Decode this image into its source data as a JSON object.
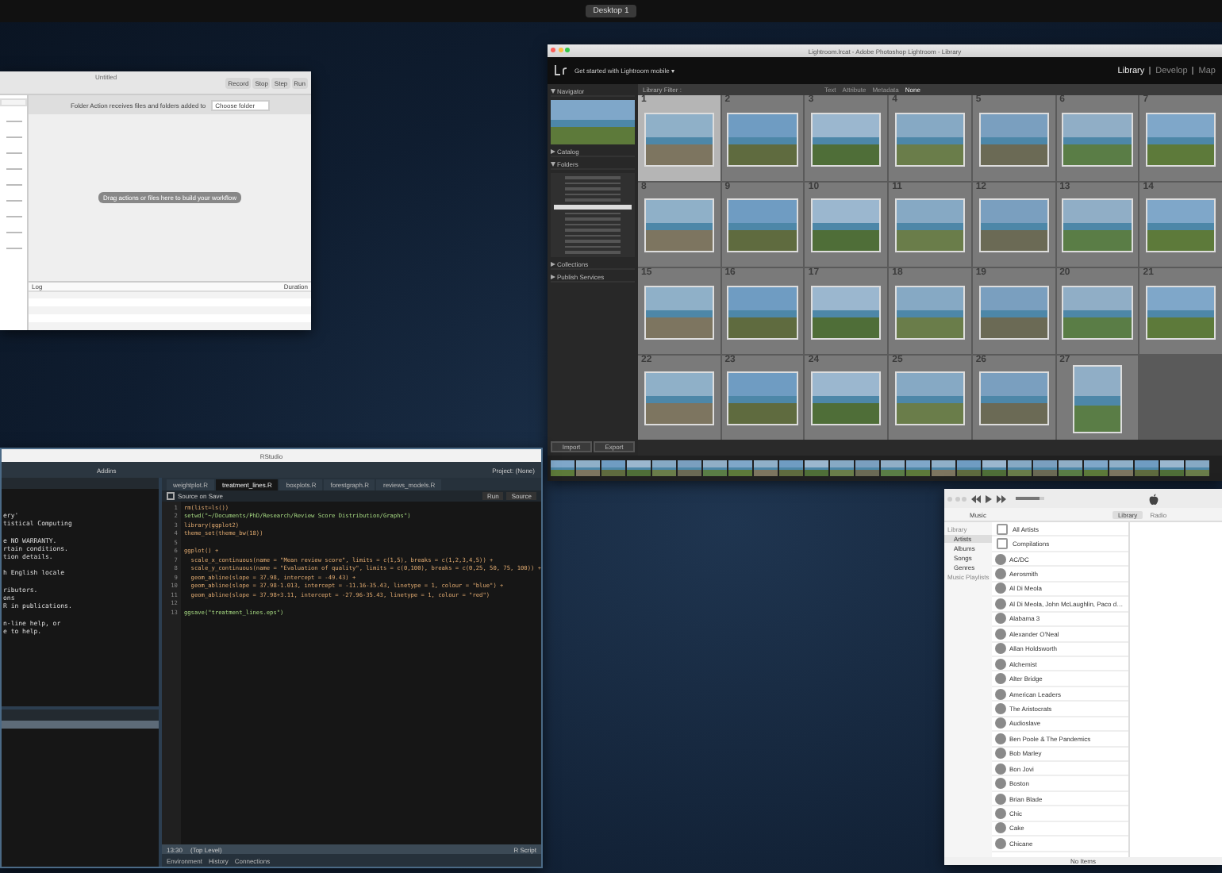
{
  "desktop_label": "Desktop 1",
  "automator": {
    "title": "Untitled",
    "toolbar": [
      "Record",
      "Stop",
      "Step",
      "Run"
    ],
    "receives_text": "Folder Action receives files and folders added to",
    "folder_value": "Choose folder",
    "hint": "Drag actions or files here to build your workflow",
    "log_columns": [
      "Log",
      "Duration"
    ]
  },
  "lightroom": {
    "title": "Lightroom.lrcat - Adobe Photoshop Lightroom - Library",
    "mobile_prompt": "Get started with Lightroom mobile ▾",
    "modules": [
      {
        "label": "Library",
        "selected": true
      },
      {
        "label": "Develop",
        "selected": false
      },
      {
        "label": "Map",
        "selected": false
      }
    ],
    "panels": [
      {
        "label": "Navigator",
        "expanded": true
      },
      {
        "label": "Catalog",
        "expanded": false
      },
      {
        "label": "Folders",
        "expanded": true
      },
      {
        "label": "Collections",
        "expanded": false
      },
      {
        "label": "Publish Services",
        "expanded": false
      }
    ],
    "filter_label": "Library Filter :",
    "filters": [
      {
        "label": "Text",
        "selected": false
      },
      {
        "label": "Attribute",
        "selected": false
      },
      {
        "label": "Metadata",
        "selected": false
      },
      {
        "label": "None",
        "selected": true
      }
    ],
    "grid": [
      {
        "number": "1",
        "selected": true
      },
      {
        "number": "2",
        "selected": false
      },
      {
        "number": "3",
        "selected": false
      },
      {
        "number": "4",
        "selected": false
      },
      {
        "number": "5",
        "selected": false
      },
      {
        "number": "6",
        "selected": false
      },
      {
        "number": "7",
        "selected": false
      },
      {
        "number": "8",
        "selected": false
      },
      {
        "number": "9",
        "selected": false
      },
      {
        "number": "10",
        "selected": false
      },
      {
        "number": "11",
        "selected": false
      },
      {
        "number": "12",
        "selected": false
      },
      {
        "number": "13",
        "selected": false
      },
      {
        "number": "14",
        "selected": false
      },
      {
        "number": "15",
        "selected": false
      },
      {
        "number": "16",
        "selected": false
      },
      {
        "number": "17",
        "selected": false
      },
      {
        "number": "18",
        "selected": false
      },
      {
        "number": "19",
        "selected": false
      },
      {
        "number": "20",
        "selected": false
      },
      {
        "number": "21",
        "selected": false
      },
      {
        "number": "22",
        "selected": false
      },
      {
        "number": "23",
        "selected": false
      },
      {
        "number": "24",
        "selected": false
      },
      {
        "number": "25",
        "selected": false
      },
      {
        "number": "26",
        "selected": false
      },
      {
        "number": "27",
        "selected": false
      }
    ],
    "buttons": [
      "Import",
      "Export"
    ]
  },
  "rstudio": {
    "title": "RStudio",
    "addins": "Addins",
    "project": "Project: (None)",
    "console_blocks": [
      [
        "ery'",
        "tistical Computing"
      ],
      [
        "e NO WARRANTY.",
        "rtain conditions.",
        "tion details."
      ],
      [
        "h English locale"
      ],
      [
        "ributors.",
        "ons",
        "R in publications."
      ],
      [
        "n-line help, or",
        "e to help."
      ]
    ],
    "tabs": [
      {
        "label": "weightplot.R",
        "selected": false
      },
      {
        "label": "treatment_lines.R",
        "selected": true
      },
      {
        "label": "boxplots.R",
        "selected": false
      },
      {
        "label": "forestgraph.R",
        "selected": false
      },
      {
        "label": "reviews_models.R",
        "selected": false
      }
    ],
    "source_on_save": {
      "label": "Source on Save",
      "checked": false
    },
    "run": "Run",
    "source": "Source",
    "code": [
      {
        "number": "1",
        "text": "rm(list=ls())"
      },
      {
        "number": "2",
        "text": "setwd(\"~/Documents/PhD/Research/Review Score Distribution/Graphs\")"
      },
      {
        "number": "3",
        "text": "library(ggplot2)"
      },
      {
        "number": "4",
        "text": "theme_set(theme_bw(18))"
      },
      {
        "number": "5"
      },
      {
        "number": "6",
        "text": "ggplot() +"
      },
      {
        "number": "7",
        "text": "  scale_x_continuous(name = \"Mean review score\", limits = c(1,5), breaks = c(1,2,3,4,5)) +"
      },
      {
        "number": "8",
        "text": "  scale_y_continuous(name = \"Evaluation of quality\", limits = c(0,100), breaks = c(0,25, 50, 75, 100)) +"
      },
      {
        "number": "9",
        "text": "  geom_abline(slope = 37.98, intercept = -49.43) +"
      },
      {
        "number": "10",
        "text": "  geom_abline(slope = 37.98-1.013, intercept = -11.16-35.43, linetype = 1, colour = \"blue\") +"
      },
      {
        "number": "11",
        "text": "  geom_abline(slope = 37.98+3.11, intercept = -27.96-35.43, linetype = 1, colour = \"red\")"
      },
      {
        "number": "12"
      },
      {
        "number": "13",
        "text": "ggsave(\"treatment_lines.eps\")"
      }
    ],
    "status": {
      "position": "13:30",
      "scope": "(Top Level)",
      "type": "R Script"
    },
    "bottom_tabs": [
      {
        "label": "Environment",
        "selected": false
      },
      {
        "label": "History",
        "selected": false
      },
      {
        "label": "Connections",
        "selected": false
      }
    ]
  },
  "itunes": {
    "volume": {
      "level": 0.85
    },
    "source": "Music",
    "view_tabs": [
      {
        "label": "Library",
        "selected": true
      },
      {
        "label": "Radio",
        "selected": false
      }
    ],
    "library_heading": "Library",
    "sidebar": [
      {
        "label": "Artists",
        "selected": true
      },
      {
        "label": "Albums",
        "selected": false
      },
      {
        "label": "Songs",
        "selected": false
      },
      {
        "label": "Genres",
        "selected": false
      }
    ],
    "playlists_heading": "Music Playlists",
    "artists": [
      "All Artists",
      "Compilations",
      "AC/DC",
      "Aerosmith",
      "Al Di Meola",
      "Al Di Meola, John McLaughlin, Paco d…",
      "Alabama 3",
      "Alexander O'Neal",
      "Allan Holdsworth",
      "Alchemist",
      "Alter Bridge",
      "American Leaders",
      "The Aristocrats",
      "Audioslave",
      "Ben Poole & The Pandemics",
      "Bob Marley",
      "Bon Jovi",
      "Boston",
      "Brian Blade",
      "Chic",
      "Cake",
      "Chicane"
    ],
    "status": "No Items"
  }
}
